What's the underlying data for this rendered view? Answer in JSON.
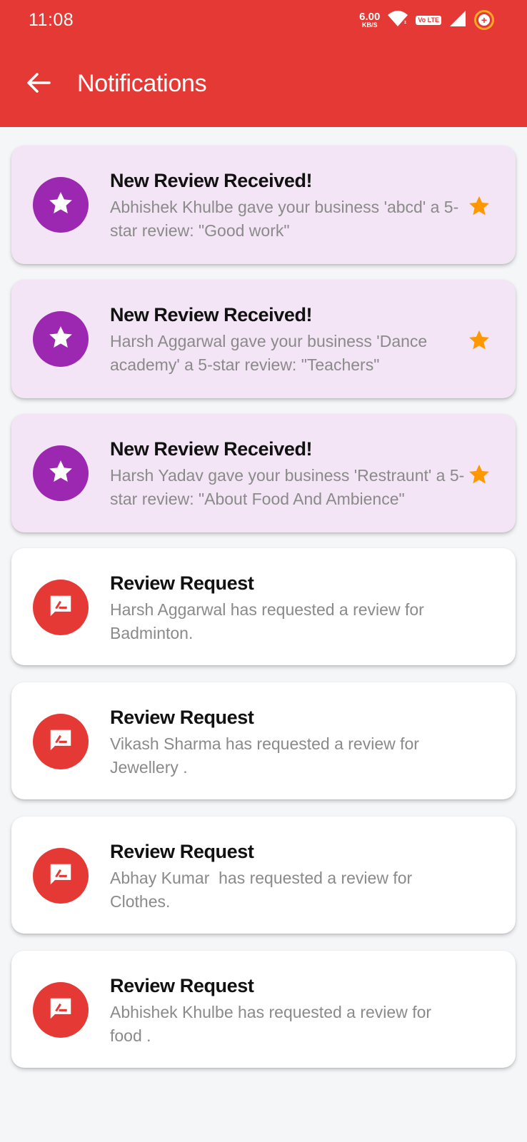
{
  "status_bar": {
    "time": "11:08",
    "net_speed_value": "6.00",
    "net_speed_unit": "KB/S",
    "volte_label": "Vo LTE",
    "icons": [
      "wifi-icon",
      "volte-icon",
      "signal-icon",
      "battery-saver-icon"
    ]
  },
  "toolbar": {
    "back_icon": "arrow-left-icon",
    "title": "Notifications"
  },
  "colors": {
    "app_bar": "#e53935",
    "review_icon_bg": "#9c27b0",
    "request_icon_bg": "#e53935",
    "unread_card_bg": "#f3e5f5",
    "star": "#ff9800"
  },
  "notifications": [
    {
      "type": "review",
      "unread": true,
      "icon": "star-icon",
      "title": "New Review Received!",
      "body": "Abhishek Khulbe gave your business 'abcd' a 5-star review: \"Good work\""
    },
    {
      "type": "review",
      "unread": true,
      "icon": "star-icon",
      "title": "New Review Received!",
      "body": "Harsh Aggarwal gave your business 'Dance academy' a 5-star review: \"Teachers\""
    },
    {
      "type": "review",
      "unread": true,
      "icon": "star-icon",
      "title": "New Review Received!",
      "body": "Harsh Yadav gave your business 'Restraunt' a 5-star review: \"About Food And Ambience\""
    },
    {
      "type": "request",
      "unread": false,
      "icon": "rate-review-icon",
      "title": "Review Request",
      "body": "Harsh Aggarwal has requested a review for Badminton."
    },
    {
      "type": "request",
      "unread": false,
      "icon": "rate-review-icon",
      "title": "Review Request",
      "body": "Vikash Sharma has requested a review for Jewellery ."
    },
    {
      "type": "request",
      "unread": false,
      "icon": "rate-review-icon",
      "title": "Review Request",
      "body": "Abhay Kumar  has requested a review for Clothes."
    },
    {
      "type": "request",
      "unread": false,
      "icon": "rate-review-icon",
      "title": "Review Request",
      "body": "Abhishek Khulbe has requested a review for food ."
    }
  ]
}
